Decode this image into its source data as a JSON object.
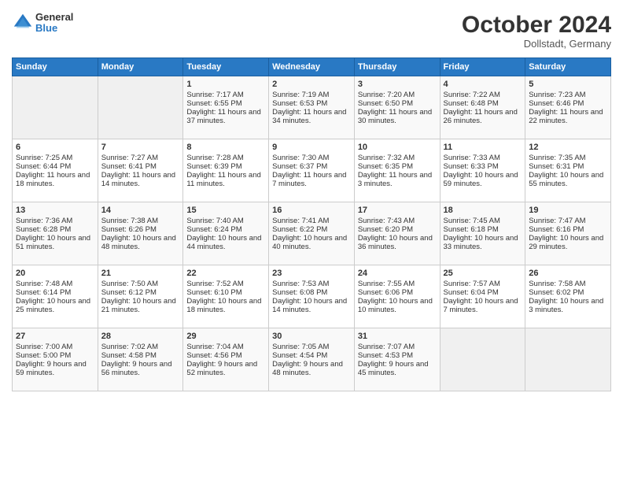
{
  "header": {
    "logo": {
      "general": "General",
      "blue": "Blue"
    },
    "title": "October 2024",
    "location": "Dollstadt, Germany"
  },
  "calendar": {
    "days_of_week": [
      "Sunday",
      "Monday",
      "Tuesday",
      "Wednesday",
      "Thursday",
      "Friday",
      "Saturday"
    ],
    "weeks": [
      [
        {
          "day": "",
          "empty": true
        },
        {
          "day": "",
          "empty": true
        },
        {
          "day": "1",
          "sunrise": "Sunrise: 7:17 AM",
          "sunset": "Sunset: 6:55 PM",
          "daylight": "Daylight: 11 hours and 37 minutes."
        },
        {
          "day": "2",
          "sunrise": "Sunrise: 7:19 AM",
          "sunset": "Sunset: 6:53 PM",
          "daylight": "Daylight: 11 hours and 34 minutes."
        },
        {
          "day": "3",
          "sunrise": "Sunrise: 7:20 AM",
          "sunset": "Sunset: 6:50 PM",
          "daylight": "Daylight: 11 hours and 30 minutes."
        },
        {
          "day": "4",
          "sunrise": "Sunrise: 7:22 AM",
          "sunset": "Sunset: 6:48 PM",
          "daylight": "Daylight: 11 hours and 26 minutes."
        },
        {
          "day": "5",
          "sunrise": "Sunrise: 7:23 AM",
          "sunset": "Sunset: 6:46 PM",
          "daylight": "Daylight: 11 hours and 22 minutes."
        }
      ],
      [
        {
          "day": "6",
          "sunrise": "Sunrise: 7:25 AM",
          "sunset": "Sunset: 6:44 PM",
          "daylight": "Daylight: 11 hours and 18 minutes."
        },
        {
          "day": "7",
          "sunrise": "Sunrise: 7:27 AM",
          "sunset": "Sunset: 6:41 PM",
          "daylight": "Daylight: 11 hours and 14 minutes."
        },
        {
          "day": "8",
          "sunrise": "Sunrise: 7:28 AM",
          "sunset": "Sunset: 6:39 PM",
          "daylight": "Daylight: 11 hours and 11 minutes."
        },
        {
          "day": "9",
          "sunrise": "Sunrise: 7:30 AM",
          "sunset": "Sunset: 6:37 PM",
          "daylight": "Daylight: 11 hours and 7 minutes."
        },
        {
          "day": "10",
          "sunrise": "Sunrise: 7:32 AM",
          "sunset": "Sunset: 6:35 PM",
          "daylight": "Daylight: 11 hours and 3 minutes."
        },
        {
          "day": "11",
          "sunrise": "Sunrise: 7:33 AM",
          "sunset": "Sunset: 6:33 PM",
          "daylight": "Daylight: 10 hours and 59 minutes."
        },
        {
          "day": "12",
          "sunrise": "Sunrise: 7:35 AM",
          "sunset": "Sunset: 6:31 PM",
          "daylight": "Daylight: 10 hours and 55 minutes."
        }
      ],
      [
        {
          "day": "13",
          "sunrise": "Sunrise: 7:36 AM",
          "sunset": "Sunset: 6:28 PM",
          "daylight": "Daylight: 10 hours and 51 minutes."
        },
        {
          "day": "14",
          "sunrise": "Sunrise: 7:38 AM",
          "sunset": "Sunset: 6:26 PM",
          "daylight": "Daylight: 10 hours and 48 minutes."
        },
        {
          "day": "15",
          "sunrise": "Sunrise: 7:40 AM",
          "sunset": "Sunset: 6:24 PM",
          "daylight": "Daylight: 10 hours and 44 minutes."
        },
        {
          "day": "16",
          "sunrise": "Sunrise: 7:41 AM",
          "sunset": "Sunset: 6:22 PM",
          "daylight": "Daylight: 10 hours and 40 minutes."
        },
        {
          "day": "17",
          "sunrise": "Sunrise: 7:43 AM",
          "sunset": "Sunset: 6:20 PM",
          "daylight": "Daylight: 10 hours and 36 minutes."
        },
        {
          "day": "18",
          "sunrise": "Sunrise: 7:45 AM",
          "sunset": "Sunset: 6:18 PM",
          "daylight": "Daylight: 10 hours and 33 minutes."
        },
        {
          "day": "19",
          "sunrise": "Sunrise: 7:47 AM",
          "sunset": "Sunset: 6:16 PM",
          "daylight": "Daylight: 10 hours and 29 minutes."
        }
      ],
      [
        {
          "day": "20",
          "sunrise": "Sunrise: 7:48 AM",
          "sunset": "Sunset: 6:14 PM",
          "daylight": "Daylight: 10 hours and 25 minutes."
        },
        {
          "day": "21",
          "sunrise": "Sunrise: 7:50 AM",
          "sunset": "Sunset: 6:12 PM",
          "daylight": "Daylight: 10 hours and 21 minutes."
        },
        {
          "day": "22",
          "sunrise": "Sunrise: 7:52 AM",
          "sunset": "Sunset: 6:10 PM",
          "daylight": "Daylight: 10 hours and 18 minutes."
        },
        {
          "day": "23",
          "sunrise": "Sunrise: 7:53 AM",
          "sunset": "Sunset: 6:08 PM",
          "daylight": "Daylight: 10 hours and 14 minutes."
        },
        {
          "day": "24",
          "sunrise": "Sunrise: 7:55 AM",
          "sunset": "Sunset: 6:06 PM",
          "daylight": "Daylight: 10 hours and 10 minutes."
        },
        {
          "day": "25",
          "sunrise": "Sunrise: 7:57 AM",
          "sunset": "Sunset: 6:04 PM",
          "daylight": "Daylight: 10 hours and 7 minutes."
        },
        {
          "day": "26",
          "sunrise": "Sunrise: 7:58 AM",
          "sunset": "Sunset: 6:02 PM",
          "daylight": "Daylight: 10 hours and 3 minutes."
        }
      ],
      [
        {
          "day": "27",
          "sunrise": "Sunrise: 7:00 AM",
          "sunset": "Sunset: 5:00 PM",
          "daylight": "Daylight: 9 hours and 59 minutes."
        },
        {
          "day": "28",
          "sunrise": "Sunrise: 7:02 AM",
          "sunset": "Sunset: 4:58 PM",
          "daylight": "Daylight: 9 hours and 56 minutes."
        },
        {
          "day": "29",
          "sunrise": "Sunrise: 7:04 AM",
          "sunset": "Sunset: 4:56 PM",
          "daylight": "Daylight: 9 hours and 52 minutes."
        },
        {
          "day": "30",
          "sunrise": "Sunrise: 7:05 AM",
          "sunset": "Sunset: 4:54 PM",
          "daylight": "Daylight: 9 hours and 48 minutes."
        },
        {
          "day": "31",
          "sunrise": "Sunrise: 7:07 AM",
          "sunset": "Sunset: 4:53 PM",
          "daylight": "Daylight: 9 hours and 45 minutes."
        },
        {
          "day": "",
          "empty": true
        },
        {
          "day": "",
          "empty": true
        }
      ]
    ]
  }
}
